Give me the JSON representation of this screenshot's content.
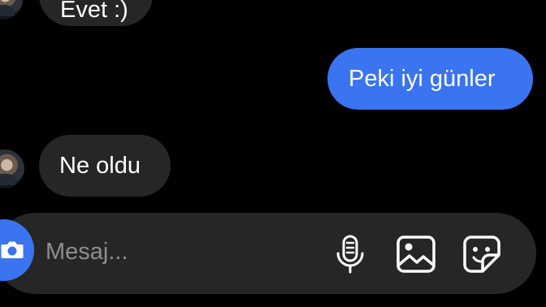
{
  "messages": [
    {
      "direction": "incoming",
      "text": "Evet :)"
    },
    {
      "direction": "outgoing",
      "text": "Peki iyi günler"
    },
    {
      "direction": "incoming",
      "text": "Ne oldu"
    }
  ],
  "composer": {
    "placeholder": "Mesaj...",
    "left_icon": "camera-icon",
    "right_icons": [
      "microphone-icon",
      "gallery-icon",
      "sticker-icon"
    ]
  },
  "colors": {
    "background": "#000000",
    "incoming_bubble": "#262626",
    "outgoing_bubble": "#3a74f0",
    "composer_bg": "#262626",
    "placeholder": "#8e8e8e",
    "camera_button": "#3a74f0"
  }
}
